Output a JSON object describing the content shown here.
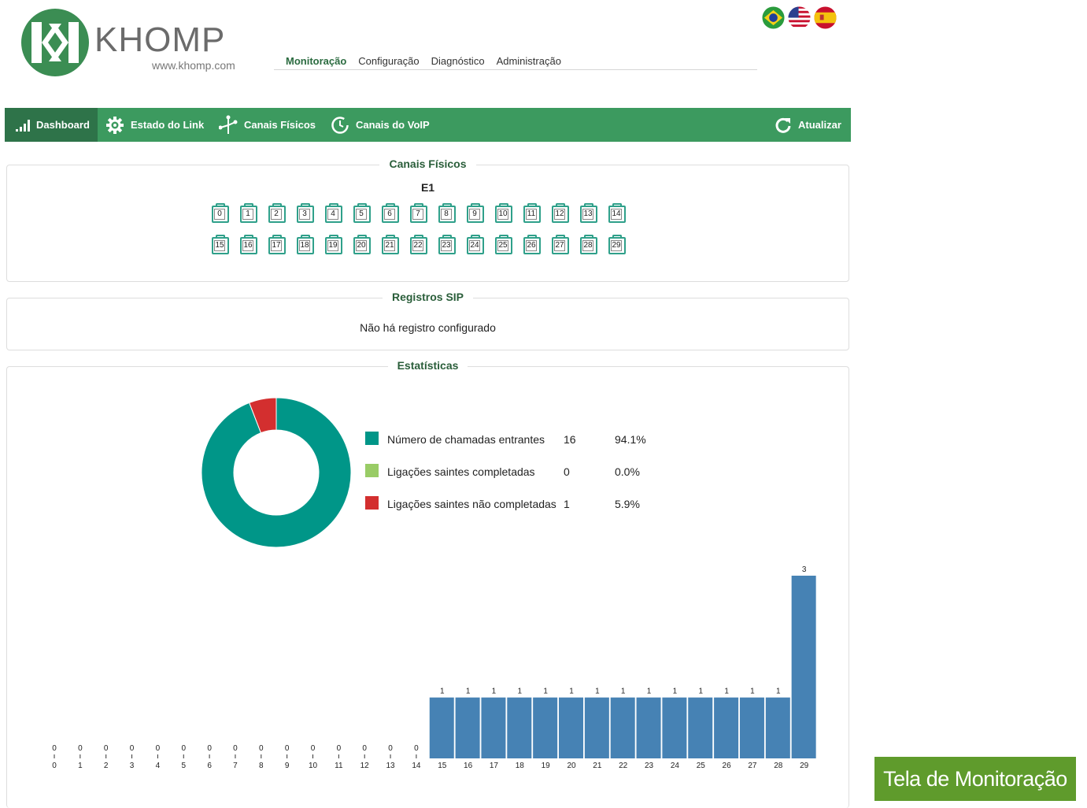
{
  "brand": {
    "name": "KHOMP",
    "url": "www.khomp.com"
  },
  "languages": [
    {
      "name": "brazil-flag-icon"
    },
    {
      "name": "usa-flag-icon"
    },
    {
      "name": "spain-flag-icon"
    }
  ],
  "top_nav": [
    "Monitoração",
    "Configuração",
    "Diagnóstico",
    "Administração"
  ],
  "toolbar": {
    "items": [
      "Dashboard",
      "Estado do Link",
      "Canais Físicos",
      "Canais do VoIP"
    ],
    "refresh": "Atualizar"
  },
  "physical_channels": {
    "title": "Canais Físicos",
    "link": "E1",
    "channels": [
      "0",
      "1",
      "2",
      "3",
      "4",
      "5",
      "6",
      "7",
      "8",
      "9",
      "10",
      "11",
      "12",
      "13",
      "14",
      "15",
      "16",
      "17",
      "18",
      "19",
      "20",
      "21",
      "22",
      "23",
      "24",
      "25",
      "26",
      "27",
      "28",
      "29"
    ]
  },
  "sip": {
    "title": "Registros SIP",
    "message": "Não há registro configurado"
  },
  "stats": {
    "title": "Estatísticas",
    "legend": [
      {
        "label": "Número de chamadas entrantes",
        "count": "16",
        "pct": "94.1%",
        "color": "#009688"
      },
      {
        "label": "Ligações saintes completadas",
        "count": "0",
        "pct": "0.0%",
        "color": "#99cc66"
      },
      {
        "label": "Ligações saintes não completadas",
        "count": "1",
        "pct": "5.9%",
        "color": "#d32f2f"
      }
    ]
  },
  "chart_data": [
    {
      "type": "pie",
      "labels": [
        "Número de chamadas entrantes",
        "Ligações saintes completadas",
        "Ligações saintes não completadas"
      ],
      "values": [
        16,
        0,
        1
      ],
      "colors": [
        "#009688",
        "#99cc66",
        "#d32f2f"
      ]
    },
    {
      "type": "bar",
      "categories": [
        "0",
        "1",
        "2",
        "3",
        "4",
        "5",
        "6",
        "7",
        "8",
        "9",
        "10",
        "11",
        "12",
        "13",
        "14",
        "15",
        "16",
        "17",
        "18",
        "19",
        "20",
        "21",
        "22",
        "23",
        "24",
        "25",
        "26",
        "27",
        "28",
        "29"
      ],
      "values": [
        0,
        0,
        0,
        0,
        0,
        0,
        0,
        0,
        0,
        0,
        0,
        0,
        0,
        0,
        0,
        1,
        1,
        1,
        1,
        1,
        1,
        1,
        1,
        1,
        1,
        1,
        1,
        1,
        1,
        3
      ],
      "ylim": [
        0,
        3
      ],
      "color": "#4682b4",
      "grid": false
    }
  ],
  "caption": "Tela de Monitoração"
}
